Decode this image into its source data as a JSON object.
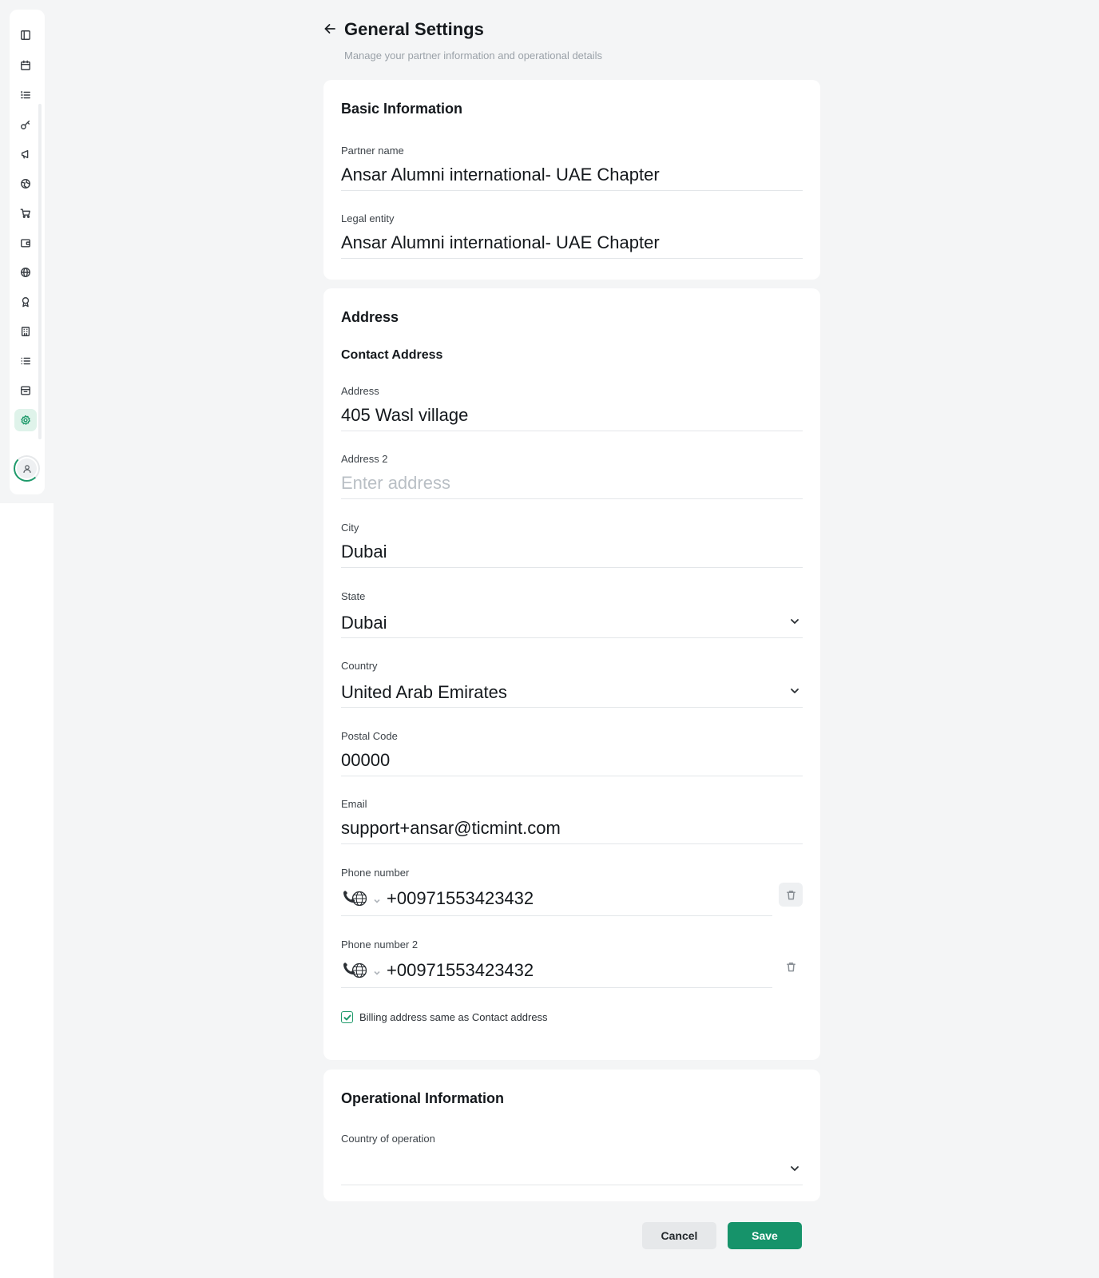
{
  "header": {
    "title": "General Settings",
    "subtitle": "Manage your partner information and operational details"
  },
  "sidebar": {
    "items": [
      {
        "icon": "panel-toggle-icon",
        "active": false
      },
      {
        "icon": "calendar-icon",
        "active": false
      },
      {
        "icon": "list-ordered-icon",
        "active": false
      },
      {
        "icon": "key-icon",
        "active": false
      },
      {
        "icon": "megaphone-icon",
        "active": false
      },
      {
        "icon": "globe-grid-icon",
        "active": false
      },
      {
        "icon": "cart-icon",
        "active": false
      },
      {
        "icon": "wallet-icon",
        "active": false
      },
      {
        "icon": "globe-icon",
        "active": false
      },
      {
        "icon": "award-icon",
        "active": false
      },
      {
        "icon": "building-icon",
        "active": false
      },
      {
        "icon": "list-icon",
        "active": false
      },
      {
        "icon": "archive-icon",
        "active": false
      },
      {
        "icon": "settings-icon",
        "active": true
      }
    ],
    "active_color": "#1f9a6b"
  },
  "basic": {
    "title": "Basic Information",
    "partner_name_label": "Partner name",
    "partner_name_value": "Ansar Alumni international- UAE Chapter",
    "legal_entity_label": "Legal entity",
    "legal_entity_value": "Ansar Alumni international- UAE Chapter"
  },
  "address": {
    "title": "Address",
    "subtitle": "Contact Address",
    "address_label": "Address",
    "address_value": "405 Wasl village",
    "address2_label": "Address 2",
    "address2_placeholder": "Enter address",
    "address2_value": "",
    "city_label": "City",
    "city_value": "Dubai",
    "state_label": "State",
    "state_value": "Dubai",
    "country_label": "Country",
    "country_value": "United Arab Emirates",
    "postal_label": "Postal Code",
    "postal_value": "00000",
    "email_label": "Email",
    "email_value": "support+ansar@ticmint.com",
    "phone_label": "Phone number",
    "phone_value": "+00971553423432",
    "phone2_label": "Phone number 2",
    "phone2_value": "+00971553423432",
    "billing_same_label": "Billing address same as Contact address",
    "billing_same_checked": true
  },
  "operational": {
    "title": "Operational Information",
    "country_of_operation_label": "Country of operation",
    "country_of_operation_value": ""
  },
  "actions": {
    "cancel_label": "Cancel",
    "save_label": "Save",
    "save_color": "#16936a"
  }
}
